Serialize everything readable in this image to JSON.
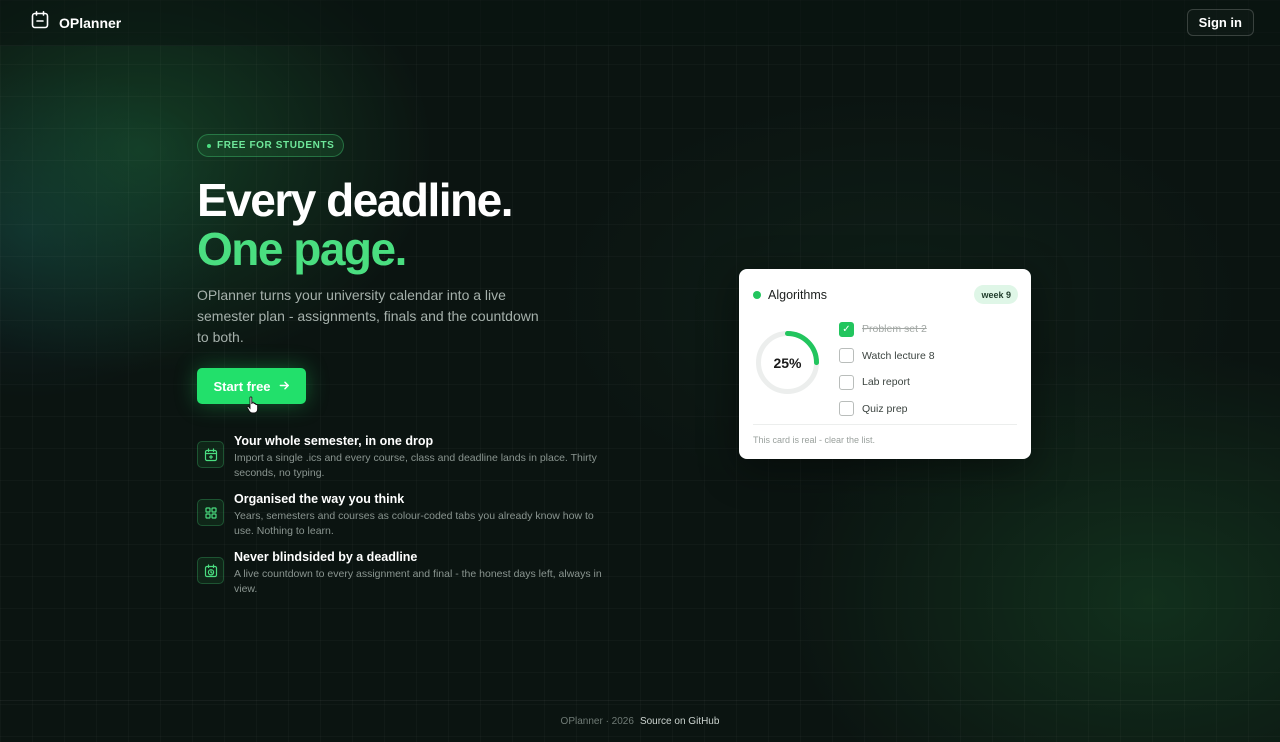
{
  "header": {
    "brand": "OPlanner",
    "signin_label": "Sign in"
  },
  "hero": {
    "badge": "FREE FOR STUDENTS",
    "headline_line1": "Every deadline.",
    "headline_line2": "One page.",
    "lead": "OPlanner turns your university calendar into a live semester plan - assignments, finals and the countdown to both.",
    "cta_label": "Start free"
  },
  "features": [
    {
      "icon": "calendar-plus-icon",
      "title": "Your whole semester, in one drop",
      "desc": "Import a single .ics and every course, class and deadline lands in place. Thirty seconds, no typing."
    },
    {
      "icon": "grid-icon",
      "title": "Organised the way you think",
      "desc": "Years, semesters and courses as colour-coded tabs you already know how to use. Nothing to learn."
    },
    {
      "icon": "calendar-clock-icon",
      "title": "Never blindsided by a deadline",
      "desc": "A live countdown to every assignment and final - the honest days left, always in view."
    }
  ],
  "card": {
    "course": "Algorithms",
    "week": "week 9",
    "progress_label": "25%",
    "progress": 0.25,
    "tasks": [
      {
        "label": "Problem set 2",
        "done": true
      },
      {
        "label": "Watch lecture 8",
        "done": false
      },
      {
        "label": "Lab report",
        "done": false
      },
      {
        "label": "Quiz prep",
        "done": false
      }
    ],
    "footnote": "This card is real - clear the list."
  },
  "footer": {
    "copyright": "OPlanner · 2026",
    "source_link": "Source on GitHub"
  },
  "colors": {
    "accent": "#4ade80",
    "cta": "#22e06b",
    "background": "#0b1411"
  }
}
